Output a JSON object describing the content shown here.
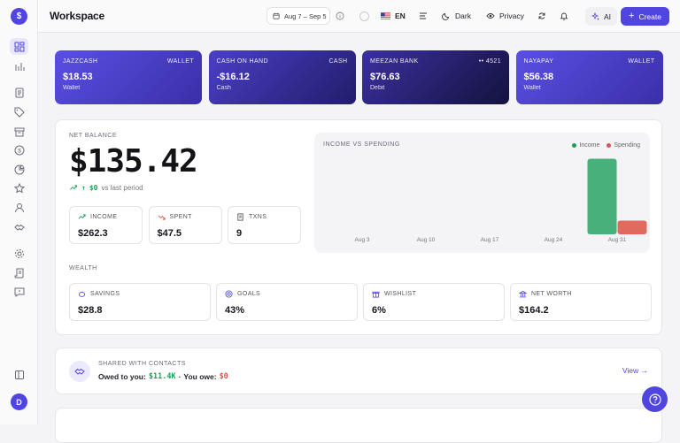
{
  "app": {
    "logo_glyph": "$",
    "user_initial": "D",
    "workspace": "Workspace"
  },
  "topbar": {
    "date_range": "Aug 7 – Sep 5",
    "language": "EN",
    "theme_label": "Dark",
    "privacy_label": "Privacy",
    "ai_label": "AI",
    "create_label": "Create"
  },
  "sidebar": {
    "items": [
      {
        "icon": "dashboard-icon",
        "active": true
      },
      {
        "icon": "bar-chart-icon"
      },
      {
        "icon": "document-icon"
      },
      {
        "icon": "tag-icon"
      },
      {
        "icon": "archive-icon"
      },
      {
        "icon": "dollar-circle-icon"
      },
      {
        "icon": "pie-chart-icon"
      },
      {
        "icon": "star-icon"
      },
      {
        "icon": "user-icon"
      },
      {
        "icon": "handshake-icon"
      },
      {
        "icon": "gear-icon"
      },
      {
        "icon": "scroll-icon"
      },
      {
        "icon": "message-icon"
      },
      {
        "icon": "book-icon"
      }
    ]
  },
  "wallets": [
    {
      "name": "JAZZCASH",
      "type": "WALLET",
      "amount": "$18.53",
      "sub": "Wallet",
      "color1": "#5a4fe3",
      "color2": "#3a2fa8"
    },
    {
      "name": "CASH ON HAND",
      "type": "CASH",
      "amount": "-$16.12",
      "sub": "Cash",
      "color1": "#4a3fc6",
      "color2": "#221d6b"
    },
    {
      "name": "MEEZAN BANK",
      "type": "•• 4521",
      "amount": "$76.63",
      "sub": "Debit",
      "color1": "#3b30a0",
      "color2": "#14123f"
    },
    {
      "name": "NAYAPAY",
      "type": "WALLET",
      "amount": "$56.38",
      "sub": "Wallet",
      "color1": "#5a4fe3",
      "color2": "#3a2fa8"
    }
  ],
  "net": {
    "label": "NET BALANCE",
    "value": "$135.42",
    "trend_arrow": "↑",
    "trend_value": "$0",
    "trend_text": "vs last period"
  },
  "stats": [
    {
      "label": "INCOME",
      "value": "$262.3",
      "icon": "trend-up-icon",
      "color": "#1f9d55"
    },
    {
      "label": "SPENT",
      "value": "$47.5",
      "icon": "trend-down-icon",
      "color": "#d9534f"
    },
    {
      "label": "TXNS",
      "value": "9",
      "icon": "receipt-icon",
      "color": "#555555"
    }
  ],
  "chart_data": {
    "type": "bar",
    "title": "INCOME VS SPENDING",
    "categories": [
      "Aug 3",
      "Aug 10",
      "Aug 17",
      "Aug 24",
      "Aug 31"
    ],
    "series": [
      {
        "name": "Income",
        "color": "#48b07a",
        "values": [
          0,
          0,
          0,
          0,
          262.3
        ]
      },
      {
        "name": "Spending",
        "color": "#e06a5e",
        "values": [
          0,
          0,
          0,
          0,
          47.5
        ]
      }
    ],
    "ylim": [
      0,
      270
    ],
    "grid": false,
    "legend": "top-right"
  },
  "wealth": {
    "label": "WEALTH",
    "items": [
      {
        "label": "SAVINGS",
        "value": "$28.8",
        "icon": "piggy-icon"
      },
      {
        "label": "GOALS",
        "value": "43%",
        "icon": "target-icon"
      },
      {
        "label": "WISHLIST",
        "value": "6%",
        "icon": "gift-icon"
      },
      {
        "label": "NET WORTH",
        "value": "$164.2",
        "icon": "bank-icon"
      }
    ]
  },
  "shared": {
    "label": "SHARED WITH CONTACTS",
    "owed_prefix": "Owed to you:",
    "owed_value": "$11.4K",
    "sep": "·",
    "owe_prefix": "You owe:",
    "owe_value": "$0",
    "view_label": "View →"
  }
}
